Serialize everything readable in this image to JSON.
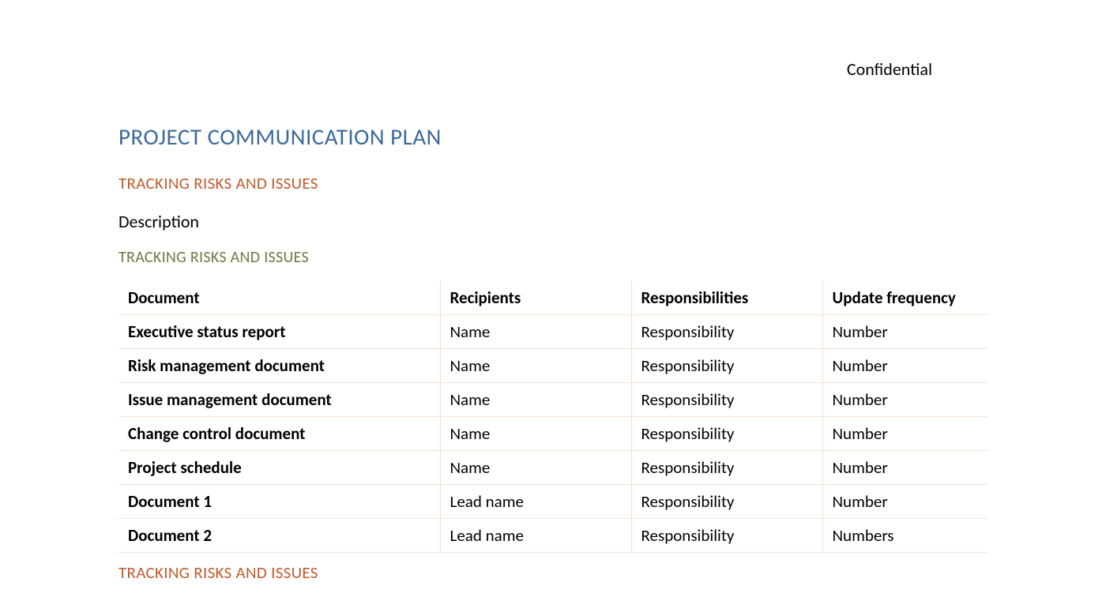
{
  "header": {
    "confidential": "Confidential"
  },
  "title": "PROJECT COMMUNICATION PLAN",
  "section1": {
    "heading": "TRACKING RISKS AND ISSUES",
    "description": "Description",
    "subheading": "TRACKING RISKS AND ISSUES"
  },
  "table": {
    "headers": [
      "Document",
      "Recipients",
      "Responsibilities",
      "Update frequency"
    ],
    "rows": [
      {
        "document": "Executive status report",
        "recipients": "Name",
        "responsibilities": "Responsibility",
        "frequency": "Number"
      },
      {
        "document": "Risk management document",
        "recipients": "Name",
        "responsibilities": "Responsibility",
        "frequency": "Number"
      },
      {
        "document": "Issue management document",
        "recipients": "Name",
        "responsibilities": "Responsibility",
        "frequency": "Number"
      },
      {
        "document": "Change control document",
        "recipients": "Name",
        "responsibilities": "Responsibility",
        "frequency": "Number"
      },
      {
        "document": "Project schedule",
        "recipients": "Name",
        "responsibilities": "Responsibility",
        "frequency": "Number"
      },
      {
        "document": "Document 1",
        "recipients": "Lead name",
        "responsibilities": "Responsibility",
        "frequency": "Number"
      },
      {
        "document": "Document 2",
        "recipients": "Lead name",
        "responsibilities": "Responsibility",
        "frequency": "Numbers"
      }
    ]
  },
  "section2": {
    "heading": "TRACKING RISKS AND ISSUES"
  }
}
